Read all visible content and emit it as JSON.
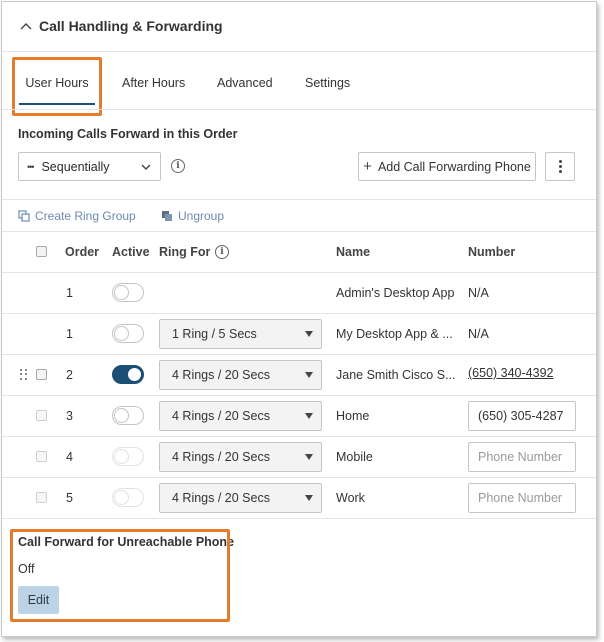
{
  "header": {
    "title": "Call Handling & Forwarding",
    "collapse_icon": "chevron-up-icon"
  },
  "tabs": [
    {
      "label": "User Hours",
      "active": true
    },
    {
      "label": "After Hours",
      "active": false
    },
    {
      "label": "Advanced",
      "active": false
    },
    {
      "label": "Settings",
      "active": false
    }
  ],
  "forward_order": {
    "label": "Incoming Calls Forward in this Order",
    "selected": "Sequentially",
    "add_button": "Add Call Forwarding Phone"
  },
  "group_actions": {
    "create": "Create Ring Group",
    "ungroup": "Ungroup"
  },
  "table": {
    "columns": {
      "order": "Order",
      "active": "Active",
      "ring_for": "Ring For",
      "name": "Name",
      "number": "Number"
    },
    "rows": [
      {
        "order": "1",
        "active": false,
        "ring_for": "",
        "name": "Admin's Desktop App",
        "number": "N/A",
        "number_type": "text"
      },
      {
        "order": "1",
        "active": false,
        "ring_for": "1 Ring / 5 Secs",
        "name": "My Desktop App & ...",
        "number": "N/A",
        "number_type": "text"
      },
      {
        "order": "2",
        "active": true,
        "ring_for": "4 Rings / 20 Secs",
        "name": "Jane Smith Cisco S...",
        "number": "(650) 340-4392",
        "number_type": "link"
      },
      {
        "order": "3",
        "active": false,
        "ring_for": "4 Rings / 20 Secs",
        "name": "Home",
        "number": "(650) 305-4287",
        "number_type": "input"
      },
      {
        "order": "4",
        "active": false,
        "ring_for": "4 Rings / 20 Secs",
        "name": "Mobile",
        "number": "",
        "number_type": "input"
      },
      {
        "order": "5",
        "active": false,
        "ring_for": "4 Rings / 20 Secs",
        "name": "Work",
        "number": "",
        "number_type": "input"
      }
    ],
    "number_placeholder": "Phone Number"
  },
  "unreachable": {
    "label": "Call Forward for Unreachable Phone",
    "value": "Off",
    "edit_button": "Edit"
  },
  "colors": {
    "accent": "#1d4e74",
    "highlight": "#e57c2c",
    "link": "#6b8bb2",
    "edit_bg": "#bcd3e6"
  }
}
